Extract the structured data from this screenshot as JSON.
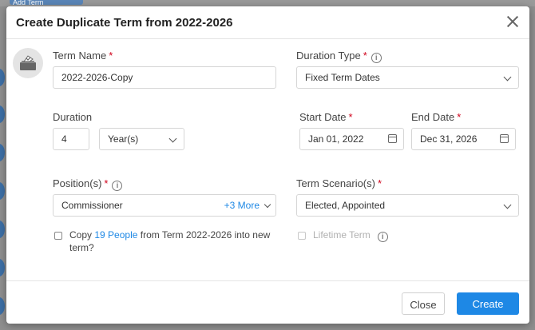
{
  "background": {
    "add_term_label": "Add Term"
  },
  "modal": {
    "title": "Create Duplicate Term from 2022-2026",
    "term_name": {
      "label": "Term Name",
      "value": "2022-2026-Copy"
    },
    "duration_type": {
      "label": "Duration Type",
      "value": "Fixed Term Dates"
    },
    "duration": {
      "label": "Duration",
      "number": "4",
      "unit": "Year(s)"
    },
    "start_date": {
      "label": "Start Date",
      "value": "Jan 01, 2022"
    },
    "end_date": {
      "label": "End Date",
      "value": "Dec 31, 2026"
    },
    "positions": {
      "label": "Position(s)",
      "value": "Commissioner",
      "more": "+3 More"
    },
    "term_scenarios": {
      "label": "Term Scenario(s)",
      "value": "Elected, Appointed"
    },
    "copy_people": {
      "pre": "Copy",
      "link": "19 People",
      "post": "from Term 2022-2026 into new",
      "line2": "term?",
      "checked": false
    },
    "lifetime_term": {
      "label": "Lifetime Term",
      "checked": false
    },
    "required_mark": "*",
    "info_glyph": "i",
    "buttons": {
      "close": "Close",
      "create": "Create"
    }
  },
  "colors": {
    "accent": "#1e88e5",
    "required": "#d0021b"
  }
}
